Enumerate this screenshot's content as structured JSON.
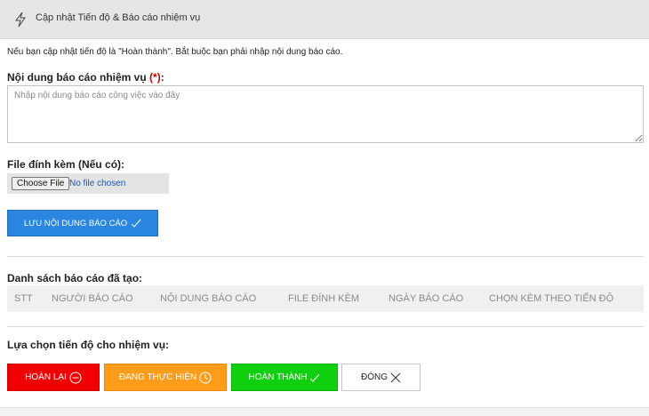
{
  "header": {
    "title": "Cập nhật Tiến độ & Báo cáo nhiệm vụ",
    "icon": "lightning-icon"
  },
  "notice": "Nếu bạn cập nhật tiến độ là \"Hoàn thành\". Bắt buộc bạn phải nhập nội dung báo cáo.",
  "report": {
    "label": "Nội dung báo cáo nhiệm vụ",
    "required_mark": "(*)",
    "label_suffix": ":",
    "placeholder": "Nhập nội dung báo cáo công việc vào đây",
    "value": ""
  },
  "attachment": {
    "label": "File đính kèm (Nếu có):",
    "choose_label": "Choose File",
    "status": "No file chosen"
  },
  "save_button": {
    "label": "Lưu nội dung báo cáo",
    "icon": "check-icon"
  },
  "reports": {
    "title": "Danh sách báo cáo đã tạo:",
    "columns": [
      "STT",
      "Người báo cáo",
      "Nội dung báo cáo",
      "File đính kèm",
      "Ngày báo cáo",
      "Chọn kèm theo tiến độ"
    ]
  },
  "progress": {
    "title": "Lựa chọn tiến độ cho nhiệm vụ:",
    "buttons": [
      {
        "label": "Hoàn lại",
        "icon": "minus-circle-icon",
        "color": "#f00000"
      },
      {
        "label": "Đang thực hiện",
        "icon": "clock-icon",
        "color": "#ff9c1a"
      },
      {
        "label": "Hoàn thành",
        "icon": "check-icon",
        "color": "#0fcf0f"
      },
      {
        "label": "Đóng",
        "icon": "close-icon",
        "color": "#ffffff"
      }
    ]
  }
}
